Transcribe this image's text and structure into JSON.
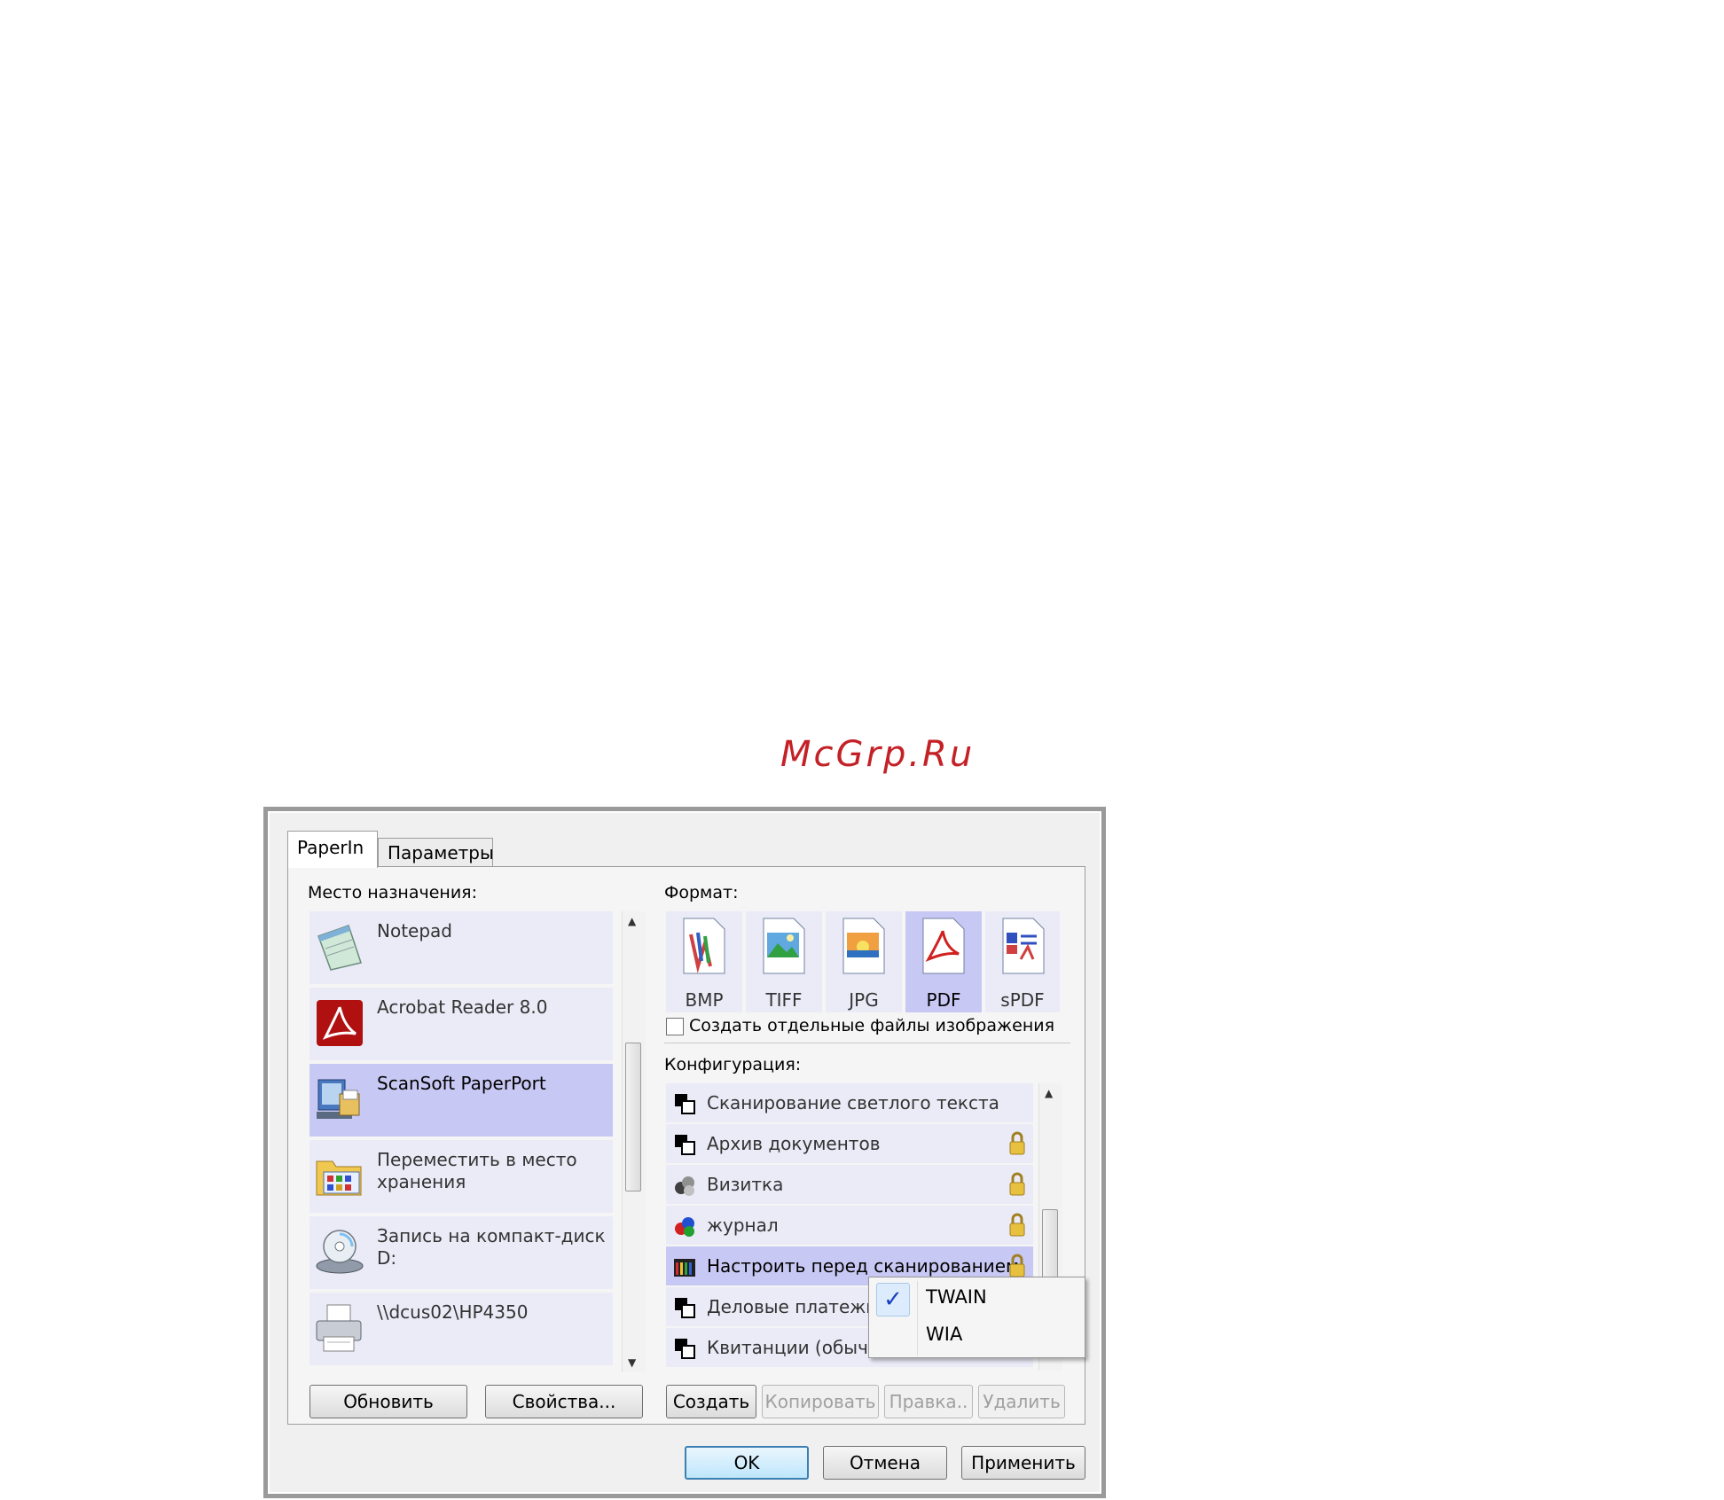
{
  "watermark": "McGrp.Ru",
  "tabs": [
    {
      "label": "PaperIn"
    },
    {
      "label": "Параметры"
    }
  ],
  "destination": {
    "label": "Место назначения:",
    "items": [
      {
        "label": "Notepad",
        "icon": "notepad-icon"
      },
      {
        "label": "Acrobat Reader 8.0",
        "icon": "acrobat-icon"
      },
      {
        "label": "ScanSoft PaperPort",
        "icon": "paperport-icon",
        "selected": true
      },
      {
        "label": "Переместить в место хранения",
        "icon": "storage-folder-icon"
      },
      {
        "label": "Запись на компакт-диск D:",
        "icon": "cd-burn-icon"
      },
      {
        "label": "\\\\dcus02\\HP4350",
        "icon": "printer-icon"
      }
    ],
    "buttons": {
      "refresh": "Обновить",
      "properties": "Свойства..."
    }
  },
  "format": {
    "label": "Формат:",
    "items": [
      {
        "label": "BMP",
        "icon": "bmp-file-icon"
      },
      {
        "label": "TIFF",
        "icon": "tiff-file-icon"
      },
      {
        "label": "JPG",
        "icon": "jpg-file-icon"
      },
      {
        "label": "PDF",
        "icon": "pdf-file-icon",
        "selected": true
      },
      {
        "label": "sPDF",
        "icon": "spdf-file-icon"
      }
    ],
    "separate_files_label": "Создать отдельные файлы изображения",
    "separate_files_checked": false
  },
  "configuration": {
    "label": "Конфигурация:",
    "items": [
      {
        "label": "Сканирование светлого текста",
        "locked": false
      },
      {
        "label": "Архив документов",
        "locked": true
      },
      {
        "label": "Визитка",
        "locked": true
      },
      {
        "label": "журнал",
        "locked": true
      },
      {
        "label": "Настроить перед сканированием",
        "locked": true,
        "selected": true
      },
      {
        "label": "Деловые платежн",
        "locked": false
      },
      {
        "label": "Квитанции (обычн",
        "locked": false
      }
    ],
    "buttons": {
      "create": "Создать",
      "copy": "Копировать",
      "edit": "Правка..",
      "delete": "Удалить"
    }
  },
  "popup_menu": {
    "items": [
      {
        "label": "TWAIN",
        "checked": true
      },
      {
        "label": "WIA",
        "checked": false
      }
    ],
    "check_glyph": "✓"
  },
  "dialog_buttons": {
    "ok": "OK",
    "cancel": "Отмена",
    "apply": "Применить"
  },
  "colors": {
    "selection": "#c8c8f4",
    "item_bg": "#ebebf8",
    "watermark": "#c42127",
    "default_button_border": "#3c7fb1"
  }
}
